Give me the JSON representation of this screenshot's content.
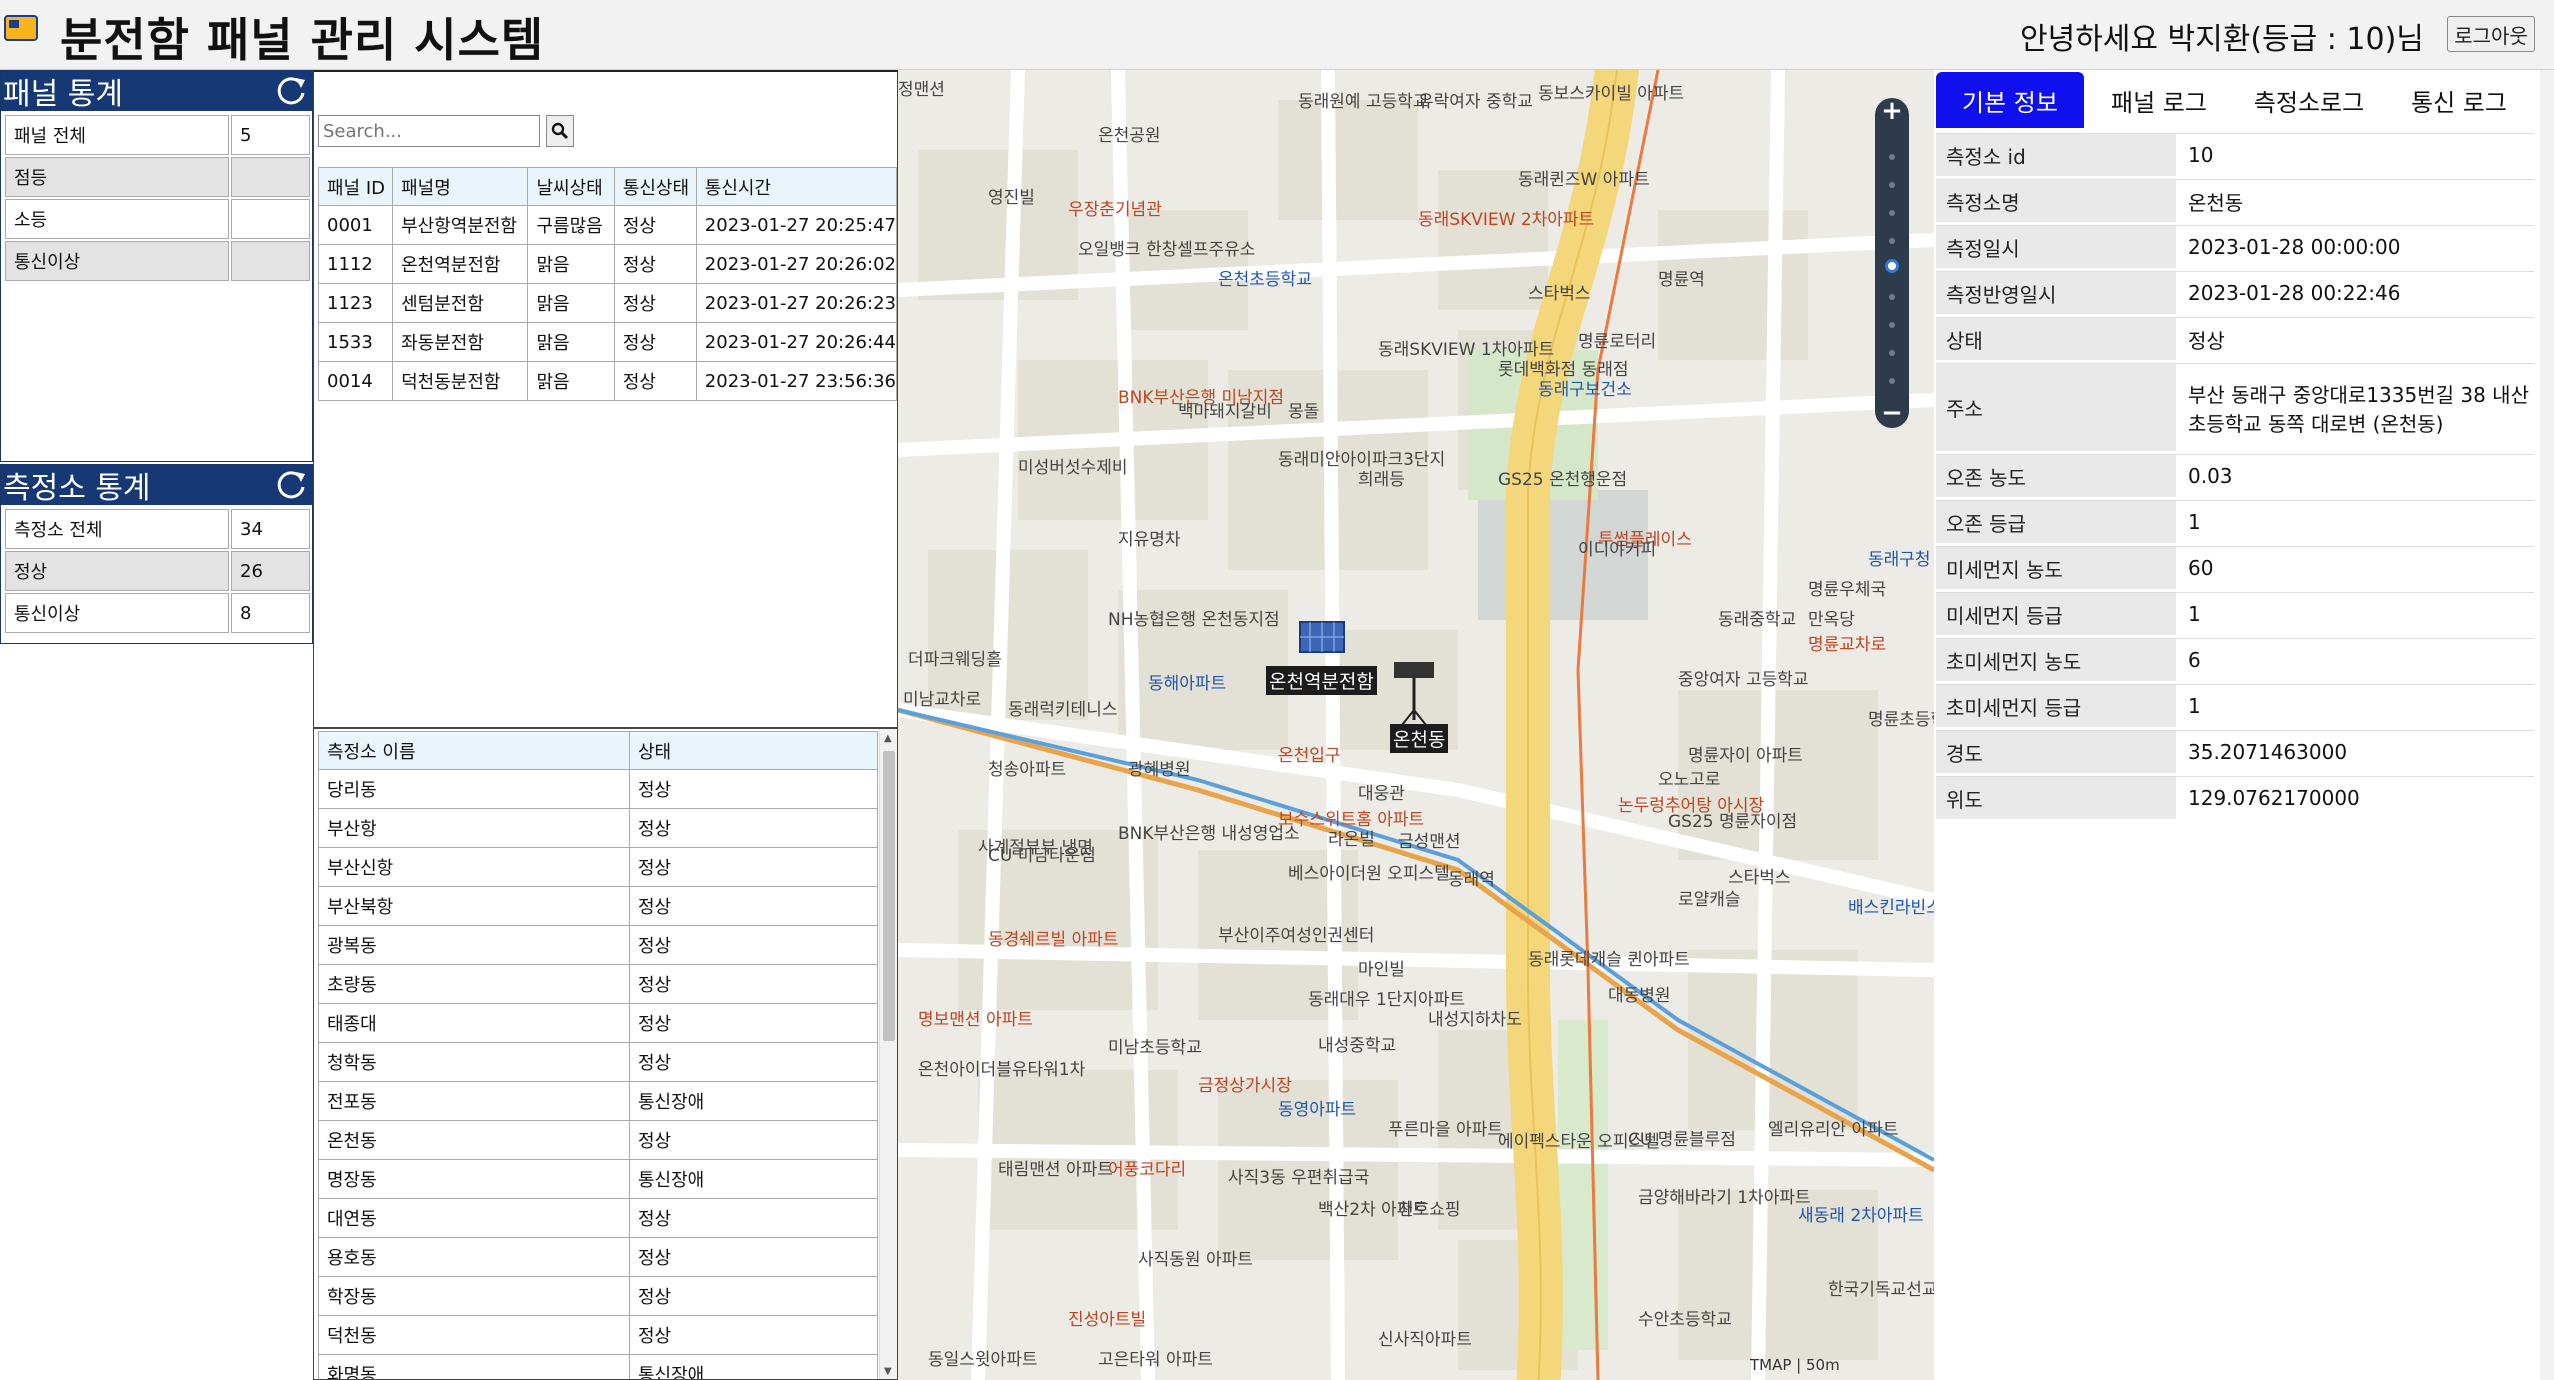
{
  "header": {
    "title": "분전함 패널 관리 시스템",
    "greeting": "안녕하세요 박지환(등급 : 10)님",
    "logout_label": "로그아웃"
  },
  "panel_stats": {
    "title": "패널 통계",
    "rows": [
      {
        "label": "패널 전체",
        "value": "5"
      },
      {
        "label": "점등",
        "value": ""
      },
      {
        "label": "소등",
        "value": ""
      },
      {
        "label": "통신이상",
        "value": ""
      }
    ]
  },
  "station_stats": {
    "title": "측정소 통계",
    "rows": [
      {
        "label": "측정소 전체",
        "value": "34"
      },
      {
        "label": "정상",
        "value": "26"
      },
      {
        "label": "통신이상",
        "value": "8"
      }
    ]
  },
  "panel_list": {
    "search_placeholder": "Search...",
    "columns": [
      "패널 ID",
      "패널명",
      "날씨상태",
      "통신상태",
      "통신시간"
    ],
    "rows": [
      [
        "0001",
        "부산항역분전함",
        "구름많음",
        "정상",
        "2023-01-27 20:25:47"
      ],
      [
        "1112",
        "온천역분전함",
        "맑음",
        "정상",
        "2023-01-27 20:26:02"
      ],
      [
        "1123",
        "센텀분전함",
        "맑음",
        "정상",
        "2023-01-27 20:26:23"
      ],
      [
        "1533",
        "좌동분전함",
        "맑음",
        "정상",
        "2023-01-27 20:26:44"
      ],
      [
        "0014",
        "덕천동분전함",
        "맑음",
        "정상",
        "2023-01-27 23:56:36"
      ]
    ]
  },
  "station_list": {
    "columns": [
      "측정소 이름",
      "상태"
    ],
    "rows": [
      [
        "당리동",
        "정상"
      ],
      [
        "부산항",
        "정상"
      ],
      [
        "부산신항",
        "정상"
      ],
      [
        "부산북항",
        "정상"
      ],
      [
        "광복동",
        "정상"
      ],
      [
        "초량동",
        "정상"
      ],
      [
        "태종대",
        "정상"
      ],
      [
        "청학동",
        "정상"
      ],
      [
        "전포동",
        "통신장애"
      ],
      [
        "온천동",
        "정상"
      ],
      [
        "명장동",
        "통신장애"
      ],
      [
        "대연동",
        "정상"
      ],
      [
        "용호동",
        "정상"
      ],
      [
        "학장동",
        "정상"
      ],
      [
        "덕천동",
        "정상"
      ],
      [
        "화명동",
        "통신장애"
      ]
    ]
  },
  "map": {
    "panel_marker_label": "온천역분전함",
    "station_marker_label": "온천동",
    "attribution": "TMAP | 50m",
    "labels": [
      "정맨션",
      "온천공원",
      "영진빌",
      "우장춘기념관",
      "오일뱅크 한창셀프주유소",
      "온천초등학교",
      "동래원예 고등학교",
      "유락여자 중학교",
      "동보스카이빌 아파트",
      "동래퀸즈W 아파트",
      "동래SKVIEW 2차아파트",
      "동래SKVIEW 1차아파트",
      "롯데백화점 동래점",
      "명륜로터리",
      "명륜역",
      "스타벅스",
      "동래구보건소",
      "BNK부산은행 미남지점",
      "백마돼지갈비",
      "몽돌",
      "미성버섯수제비",
      "동래미안아이파크3단지",
      "희래등",
      "GS25 온천행운점",
      "투썸플레이스",
      "지유명차",
      "NH농협은행 온천동지점",
      "동해아파트",
      "동래럭키테니스",
      "청송아파트",
      "광혜병원",
      "온천입구",
      "대웅관",
      "이디야커피",
      "동래중학교",
      "중앙여자 고등학교",
      "명륜자이 아파트",
      "오노고로",
      "보수스위트홈 아파트",
      "BNK부산은행 내성영업소",
      "베스아이더원 오피스텔",
      "라온빌",
      "금성맨션",
      "사계절부부 냉면",
      "동래역",
      "논두렁추어탕 아시장",
      "GS25 명륜자이점",
      "로얄캐슬",
      "스타벅스",
      "배스킨라빈스",
      "동래롯데캐슬 퀸아파트",
      "대동병원",
      "동경쉐르빌 아파트",
      "부산이주여성인권센터",
      "마인빌",
      "동래대우 1단지아파트",
      "내성지하차도",
      "내성중학교",
      "미남초등학교",
      "금정상가시장",
      "동영아파트",
      "푸른마을 아파트",
      "에이펙스타운 오피스텔",
      "CU 명륜블루점",
      "엘리유리안 아파트",
      "태림맨션 아파트",
      "어풍코다리",
      "사직3동 우편취급국",
      "백산2차 아파트",
      "천호쇼핑",
      "금양해바라기 1차아파트",
      "새동래 2차아파트",
      "사직동원 아파트",
      "진성아트빌",
      "고은타워 아파트",
      "신사직아파트",
      "수안초등학교",
      "한국기독교선교 박물관",
      "명륜우체국",
      "만옥당",
      "명륜교차로",
      "명륜초등학교",
      "동래구청",
      "미남교차로",
      "더파크웨딩홀",
      "동일스윗아파트",
      "CU 미남타운점",
      "명보맨션 아파트",
      "온천아이더블유타워1차"
    ]
  },
  "info_panel": {
    "tabs": [
      "기본 정보",
      "패널 로그",
      "측정소로그",
      "통신 로그"
    ],
    "active_tab": 0,
    "rows": [
      {
        "key": "측정소 id",
        "value": "10"
      },
      {
        "key": "측정소명",
        "value": "온천동"
      },
      {
        "key": "측정일시",
        "value": "2023-01-28 00:00:00"
      },
      {
        "key": "측정반영일시",
        "value": "2023-01-28 00:22:46"
      },
      {
        "key": "상태",
        "value": "정상"
      },
      {
        "key": "주소",
        "value": "부산 동래구 중앙대로1335번길 38 내산초등학교 동쪽 대로변 (온천동)"
      },
      {
        "key": "오존 농도",
        "value": "0.03"
      },
      {
        "key": "오존 등급",
        "value": "1"
      },
      {
        "key": "미세먼지 농도",
        "value": "60"
      },
      {
        "key": "미세먼지 등급",
        "value": "1"
      },
      {
        "key": "초미세먼지 농도",
        "value": "6"
      },
      {
        "key": "초미세먼지 등급",
        "value": "1"
      },
      {
        "key": "경도",
        "value": "35.2071463000"
      },
      {
        "key": "위도",
        "value": "129.0762170000"
      }
    ]
  },
  "colors": {
    "stat_header": "#163874",
    "active_tab": "#1010ee",
    "table_header": "#eaf4fb",
    "map_road_main": "#f3d77a",
    "map_subway": "#e88a3c"
  }
}
